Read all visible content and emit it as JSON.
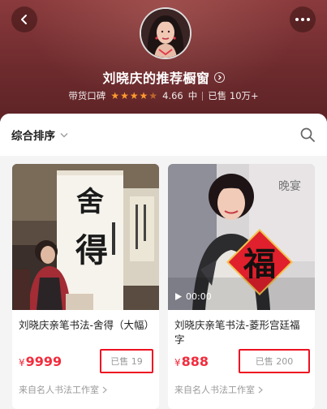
{
  "header": {
    "shop_title": "刘晓庆的推荐橱窗",
    "rating_label": "带货口碑",
    "rating_value": "4.66",
    "rating_level": "中",
    "sold_total": "已售 10万+",
    "star_count_full": 4,
    "star_count_partial": 1
  },
  "toolbar": {
    "sort_label": "综合排序"
  },
  "products": [
    {
      "title": "刘晓庆亲笔书法-舍得（大幅）",
      "price_symbol": "¥",
      "price": "9999",
      "sold": "已售 19",
      "shop": "来自名人书法工作室",
      "image_caption_chars": "舍得"
    },
    {
      "title": "刘晓庆亲笔书法-菱形宫廷福字",
      "price_symbol": "¥",
      "price": "888",
      "sold": "已售 200",
      "shop": "来自名人书法工作室",
      "video_duration": "00:00",
      "image_caption_chars": "福"
    }
  ],
  "colors": {
    "header_bg": "#7a3235",
    "accent_red": "#f22c3d",
    "highlight_box": "#ee1122",
    "star": "#ff9b2e"
  },
  "icons": {
    "back": "chevron-left-icon",
    "more": "more-dots-icon",
    "title_arrow": "circle-arrow-right-icon",
    "sort": "chevron-down-icon",
    "search": "search-icon",
    "shop_arrow": "chevron-right-icon",
    "play": "play-icon"
  }
}
